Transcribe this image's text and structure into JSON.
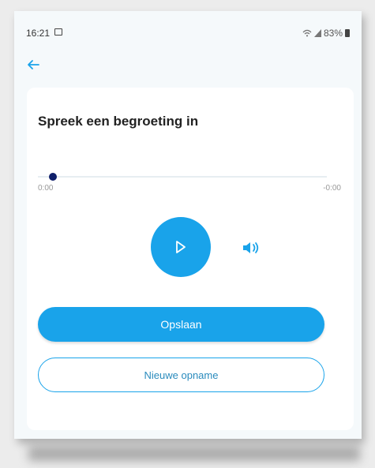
{
  "status_bar": {
    "time": "16:21",
    "battery": "83%"
  },
  "screen": {
    "title": "Spreek een begroeting in"
  },
  "player": {
    "elapsed": "0:00",
    "remaining": "-0:00",
    "progress": 0
  },
  "actions": {
    "save_label": "Opslaan",
    "new_recording_label": "Nieuwe opname"
  },
  "colors": {
    "accent": "#19a3ea",
    "thumb": "#0f1f6a"
  }
}
